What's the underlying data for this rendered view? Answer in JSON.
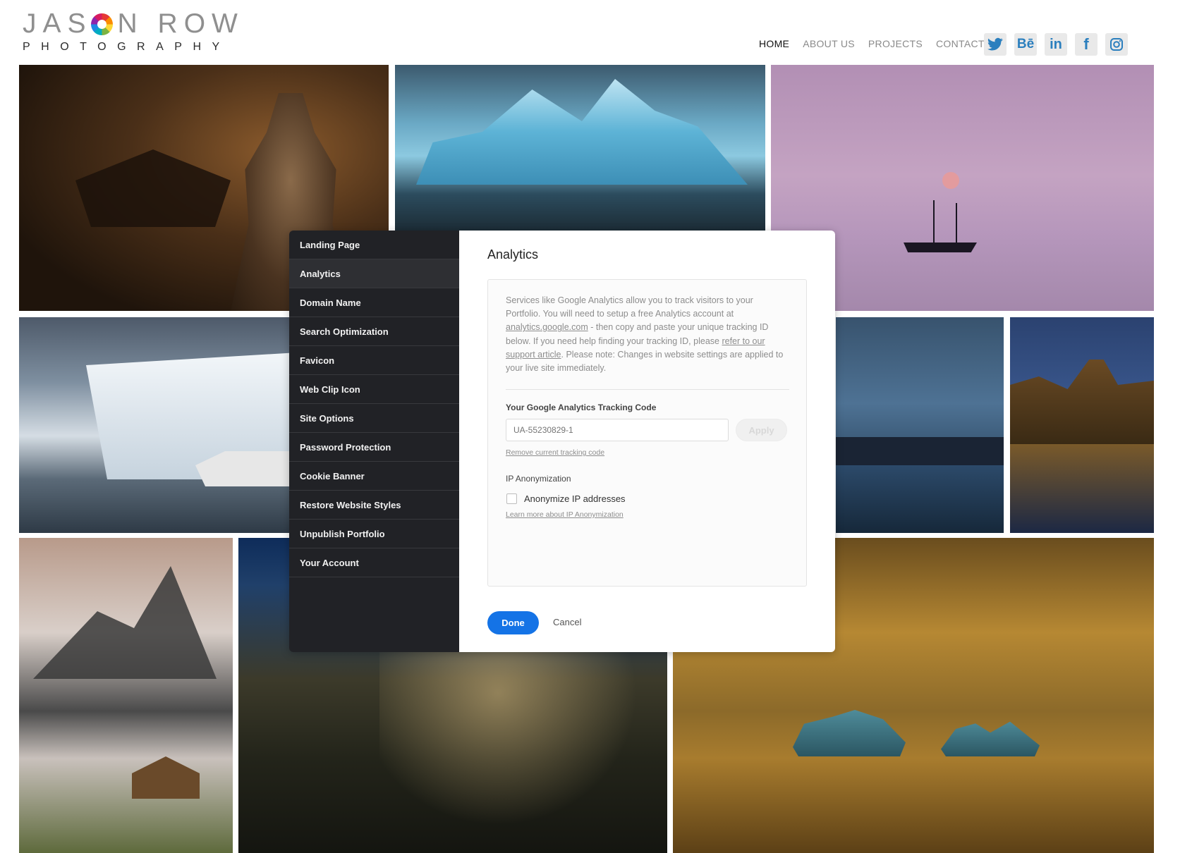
{
  "brand": {
    "line1_left": "JAS",
    "line1_right": "N ROW",
    "line2": "PHOTOGRAPHY"
  },
  "nav": {
    "items": [
      "HOME",
      "ABOUT US",
      "PROJECTS",
      "CONTACT"
    ],
    "active": "HOME"
  },
  "social": [
    {
      "icon": "twitter-icon",
      "glyph": "t"
    },
    {
      "icon": "behance-icon",
      "glyph": "Bē"
    },
    {
      "icon": "linkedin-icon",
      "glyph": "in"
    },
    {
      "icon": "facebook-icon",
      "glyph": "f"
    },
    {
      "icon": "instagram-icon",
      "glyph": "◎"
    }
  ],
  "settings": {
    "menu": [
      "Landing Page",
      "Analytics",
      "Domain Name",
      "Search Optimization",
      "Favicon",
      "Web Clip Icon",
      "Site Options",
      "Password Protection",
      "Cookie Banner",
      "Restore Website Styles",
      "Unpublish Portfolio",
      "Your Account"
    ],
    "active_index": 1
  },
  "analytics": {
    "title": "Analytics",
    "desc_part1": "Services like Google Analytics allow you to track visitors to your Portfolio. You will need to setup a free Analytics account at ",
    "desc_link1": "analytics.google.com",
    "desc_part2": " - then copy and paste your unique tracking ID below. If you need help finding your tracking ID, please ",
    "desc_link2": "refer to our support article",
    "desc_part3": ". Please note: Changes in website settings are applied to your live site immediately.",
    "tracking_label": "Your Google Analytics Tracking Code",
    "tracking_placeholder": "UA-55230829-1",
    "apply_label": "Apply",
    "remove_label": "Remove current tracking code",
    "ip_label": "IP Anonymization",
    "anonymize_label": "Anonymize IP addresses",
    "learn_label": "Learn more about IP Anonymization",
    "done_label": "Done",
    "cancel_label": "Cancel"
  },
  "colors": {
    "accent": "#1473e6",
    "sidebar": "#212226",
    "social_blue": "#2b7fbe"
  }
}
